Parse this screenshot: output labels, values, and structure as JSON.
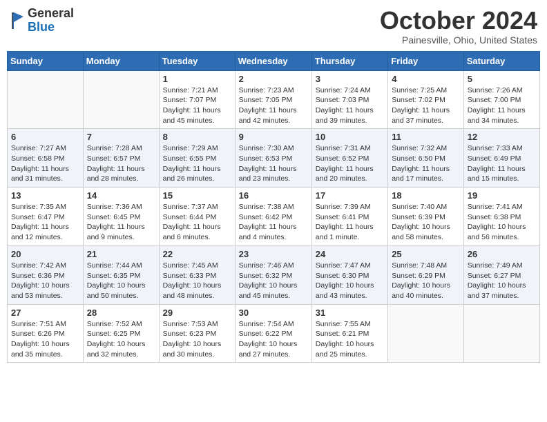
{
  "header": {
    "logo_general": "General",
    "logo_blue": "Blue",
    "month_title": "October 2024",
    "location": "Painesville, Ohio, United States"
  },
  "days_of_week": [
    "Sunday",
    "Monday",
    "Tuesday",
    "Wednesday",
    "Thursday",
    "Friday",
    "Saturday"
  ],
  "weeks": [
    [
      {
        "day": "",
        "empty": true
      },
      {
        "day": "",
        "empty": true
      },
      {
        "day": "1",
        "sunrise": "7:21 AM",
        "sunset": "7:07 PM",
        "daylight": "11 hours and 45 minutes."
      },
      {
        "day": "2",
        "sunrise": "7:23 AM",
        "sunset": "7:05 PM",
        "daylight": "11 hours and 42 minutes."
      },
      {
        "day": "3",
        "sunrise": "7:24 AM",
        "sunset": "7:03 PM",
        "daylight": "11 hours and 39 minutes."
      },
      {
        "day": "4",
        "sunrise": "7:25 AM",
        "sunset": "7:02 PM",
        "daylight": "11 hours and 37 minutes."
      },
      {
        "day": "5",
        "sunrise": "7:26 AM",
        "sunset": "7:00 PM",
        "daylight": "11 hours and 34 minutes."
      }
    ],
    [
      {
        "day": "6",
        "sunrise": "7:27 AM",
        "sunset": "6:58 PM",
        "daylight": "11 hours and 31 minutes."
      },
      {
        "day": "7",
        "sunrise": "7:28 AM",
        "sunset": "6:57 PM",
        "daylight": "11 hours and 28 minutes."
      },
      {
        "day": "8",
        "sunrise": "7:29 AM",
        "sunset": "6:55 PM",
        "daylight": "11 hours and 26 minutes."
      },
      {
        "day": "9",
        "sunrise": "7:30 AM",
        "sunset": "6:53 PM",
        "daylight": "11 hours and 23 minutes."
      },
      {
        "day": "10",
        "sunrise": "7:31 AM",
        "sunset": "6:52 PM",
        "daylight": "11 hours and 20 minutes."
      },
      {
        "day": "11",
        "sunrise": "7:32 AM",
        "sunset": "6:50 PM",
        "daylight": "11 hours and 17 minutes."
      },
      {
        "day": "12",
        "sunrise": "7:33 AM",
        "sunset": "6:49 PM",
        "daylight": "11 hours and 15 minutes."
      }
    ],
    [
      {
        "day": "13",
        "sunrise": "7:35 AM",
        "sunset": "6:47 PM",
        "daylight": "11 hours and 12 minutes."
      },
      {
        "day": "14",
        "sunrise": "7:36 AM",
        "sunset": "6:45 PM",
        "daylight": "11 hours and 9 minutes."
      },
      {
        "day": "15",
        "sunrise": "7:37 AM",
        "sunset": "6:44 PM",
        "daylight": "11 hours and 6 minutes."
      },
      {
        "day": "16",
        "sunrise": "7:38 AM",
        "sunset": "6:42 PM",
        "daylight": "11 hours and 4 minutes."
      },
      {
        "day": "17",
        "sunrise": "7:39 AM",
        "sunset": "6:41 PM",
        "daylight": "11 hours and 1 minute."
      },
      {
        "day": "18",
        "sunrise": "7:40 AM",
        "sunset": "6:39 PM",
        "daylight": "10 hours and 58 minutes."
      },
      {
        "day": "19",
        "sunrise": "7:41 AM",
        "sunset": "6:38 PM",
        "daylight": "10 hours and 56 minutes."
      }
    ],
    [
      {
        "day": "20",
        "sunrise": "7:42 AM",
        "sunset": "6:36 PM",
        "daylight": "10 hours and 53 minutes."
      },
      {
        "day": "21",
        "sunrise": "7:44 AM",
        "sunset": "6:35 PM",
        "daylight": "10 hours and 50 minutes."
      },
      {
        "day": "22",
        "sunrise": "7:45 AM",
        "sunset": "6:33 PM",
        "daylight": "10 hours and 48 minutes."
      },
      {
        "day": "23",
        "sunrise": "7:46 AM",
        "sunset": "6:32 PM",
        "daylight": "10 hours and 45 minutes."
      },
      {
        "day": "24",
        "sunrise": "7:47 AM",
        "sunset": "6:30 PM",
        "daylight": "10 hours and 43 minutes."
      },
      {
        "day": "25",
        "sunrise": "7:48 AM",
        "sunset": "6:29 PM",
        "daylight": "10 hours and 40 minutes."
      },
      {
        "day": "26",
        "sunrise": "7:49 AM",
        "sunset": "6:27 PM",
        "daylight": "10 hours and 37 minutes."
      }
    ],
    [
      {
        "day": "27",
        "sunrise": "7:51 AM",
        "sunset": "6:26 PM",
        "daylight": "10 hours and 35 minutes."
      },
      {
        "day": "28",
        "sunrise": "7:52 AM",
        "sunset": "6:25 PM",
        "daylight": "10 hours and 32 minutes."
      },
      {
        "day": "29",
        "sunrise": "7:53 AM",
        "sunset": "6:23 PM",
        "daylight": "10 hours and 30 minutes."
      },
      {
        "day": "30",
        "sunrise": "7:54 AM",
        "sunset": "6:22 PM",
        "daylight": "10 hours and 27 minutes."
      },
      {
        "day": "31",
        "sunrise": "7:55 AM",
        "sunset": "6:21 PM",
        "daylight": "10 hours and 25 minutes."
      },
      {
        "day": "",
        "empty": true
      },
      {
        "day": "",
        "empty": true
      }
    ]
  ]
}
